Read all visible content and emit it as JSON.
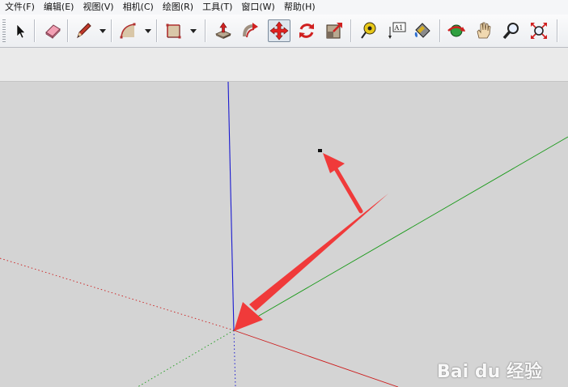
{
  "menu": {
    "items": [
      {
        "label": "文件(F)"
      },
      {
        "label": "编辑(E)"
      },
      {
        "label": "视图(V)"
      },
      {
        "label": "相机(C)"
      },
      {
        "label": "绘图(R)"
      },
      {
        "label": "工具(T)"
      },
      {
        "label": "窗口(W)"
      },
      {
        "label": "帮助(H)"
      }
    ]
  },
  "toolbar": {
    "tools": [
      {
        "name": "select-tool",
        "icon": "arrow-cursor-icon"
      },
      {
        "name": "eraser-tool",
        "icon": "eraser-icon"
      },
      {
        "name": "pencil-tool",
        "icon": "pencil-icon"
      },
      {
        "name": "arc-tool",
        "icon": "arc-icon"
      },
      {
        "name": "rectangle-tool",
        "icon": "rectangle-icon"
      },
      {
        "name": "push-pull-tool",
        "icon": "push-pull-icon"
      },
      {
        "name": "follow-me-tool",
        "icon": "follow-me-icon"
      },
      {
        "name": "move-tool",
        "icon": "move-icon",
        "active": true
      },
      {
        "name": "rotate-tool",
        "icon": "rotate-icon"
      },
      {
        "name": "scale-tool",
        "icon": "scale-icon"
      },
      {
        "name": "tape-measure-tool",
        "icon": "tape-measure-icon"
      },
      {
        "name": "text-tool",
        "icon": "text-label-icon",
        "label": "A1"
      },
      {
        "name": "paint-bucket-tool",
        "icon": "paint-bucket-icon"
      },
      {
        "name": "orbit-tool",
        "icon": "orbit-icon"
      },
      {
        "name": "pan-tool",
        "icon": "hand-icon"
      },
      {
        "name": "zoom-tool",
        "icon": "magnifier-icon"
      },
      {
        "name": "zoom-extents-tool",
        "icon": "zoom-extents-icon"
      }
    ]
  },
  "watermark": {
    "text": "Bai du 经验"
  },
  "colors": {
    "axis_blue": "#1a1ad0",
    "axis_red": "#cc1a1a",
    "axis_green": "#1a9a1a",
    "annotation_arrow": "#f03a3a",
    "viewport_bg": "#d4d4d4"
  }
}
